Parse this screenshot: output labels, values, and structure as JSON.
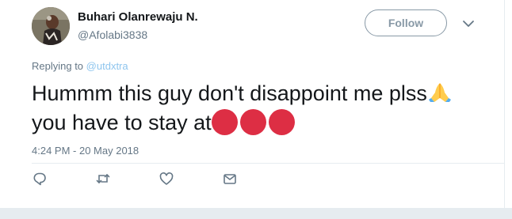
{
  "tweet": {
    "author_name": "Buhari Olanrewaju N.",
    "handle": "@Afolabi3838",
    "follow_label": "Follow",
    "replying_prefix": "Replying to",
    "replying_to": "@utdxtra",
    "text_line1": "Hummm this guy don't disappoint me plss",
    "text_line2": "you have to stay at",
    "emoji_line1": "folded-hands",
    "emoji_line2": [
      "red-circle",
      "red-circle",
      "red-circle"
    ],
    "timestamp": "4:24 PM - 20 May 2018"
  },
  "actions": [
    "reply-icon",
    "retweet-icon",
    "like-icon",
    "direct-message-icon"
  ],
  "colors": {
    "text": "#14171a",
    "secondary": "#657786",
    "mention": "#8ec5ee",
    "follow_border": "#8899a6",
    "divider": "#e6ecf0",
    "red_circle": "#dd2e44"
  }
}
